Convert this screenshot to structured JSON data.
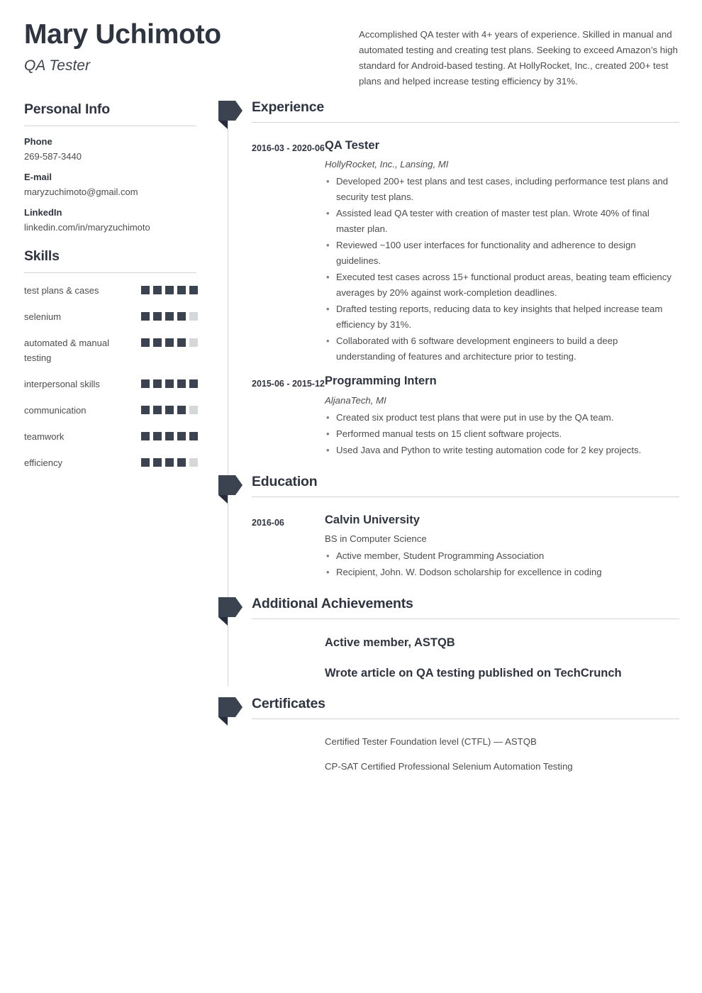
{
  "header": {
    "name": "Mary Uchimoto",
    "job_title": "QA Tester",
    "summary": "Accomplished QA tester with 4+ years of experience. Skilled in manual and automated testing and creating test plans. Seeking to exceed Amazon’s high standard for Android-based testing. At HollyRocket, Inc., created 200+ test plans and helped increase testing efficiency by 31%."
  },
  "sidebar": {
    "personal_info": {
      "heading": "Personal Info",
      "fields": [
        {
          "label": "Phone",
          "value": "269-587-3440"
        },
        {
          "label": "E-mail",
          "value": "maryzuchimoto@gmail.com"
        },
        {
          "label": "LinkedIn",
          "value": "linkedin.com/in/maryzuchimoto"
        }
      ]
    },
    "skills": {
      "heading": "Skills",
      "max_rating": 5,
      "items": [
        {
          "name": "test plans & cases",
          "rating": 5
        },
        {
          "name": "selenium",
          "rating": 4
        },
        {
          "name": "automated & manual testing",
          "rating": 4
        },
        {
          "name": "interpersonal skills",
          "rating": 5
        },
        {
          "name": "communication",
          "rating": 4
        },
        {
          "name": "teamwork",
          "rating": 5
        },
        {
          "name": "efficiency",
          "rating": 4
        }
      ]
    }
  },
  "main": {
    "experience": {
      "heading": "Experience",
      "entries": [
        {
          "date": "2016-03 - 2020-06",
          "role": "QA Tester",
          "org": "HollyRocket, Inc., Lansing, MI",
          "bullets": [
            "Developed 200+ test plans and test cases, including performance test plans and security test plans.",
            "Assisted lead QA tester with creation of master test plan. Wrote 40% of final master plan.",
            "Reviewed ~100 user interfaces for functionality and adherence to design guidelines.",
            "Executed test cases across 15+ functional product areas, beating team efficiency averages by 20% against work-completion deadlines.",
            "Drafted testing reports, reducing data to key insights that helped increase team efficiency by 31%.",
            "Collaborated with 6 software development engineers to build a deep understanding of features and architecture prior to testing."
          ]
        },
        {
          "date": "2015-06 - 2015-12",
          "role": "Programming Intern",
          "org": "AljanaTech, MI",
          "bullets": [
            "Created six product test plans that were put in use by the QA team.",
            "Performed manual tests on 15 client software projects.",
            "Used Java and Python to write testing automation code for 2 key projects."
          ]
        }
      ]
    },
    "education": {
      "heading": "Education",
      "entries": [
        {
          "date": "2016-06",
          "role": "Calvin University",
          "org": "BS in Computer Science",
          "bullets": [
            "Active member, Student Programming Association",
            "Recipient, John. W. Dodson scholarship for excellence in coding"
          ]
        }
      ]
    },
    "achievements": {
      "heading": "Additional Achievements",
      "items": [
        "Active member, ASTQB",
        "Wrote article on QA testing published on TechCrunch"
      ]
    },
    "certificates": {
      "heading": "Certificates",
      "items": [
        "Certified Tester Foundation level (CTFL) — ASTQB",
        "CP-SAT Certified Professional Selenium Automation Testing"
      ]
    }
  },
  "theme": {
    "accent": "#3b4250",
    "heading": "#2e3440",
    "body_text": "#4d4d4d",
    "rule": "#d4d4d4",
    "empty_square": "#d5d7d9"
  }
}
